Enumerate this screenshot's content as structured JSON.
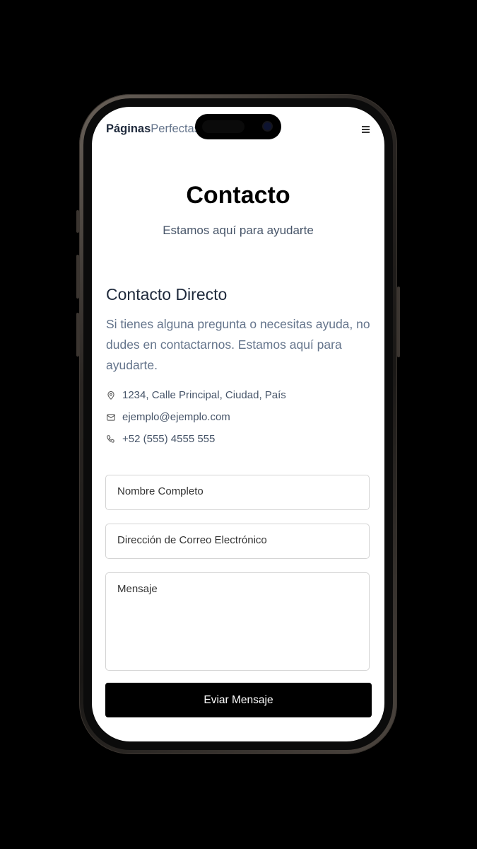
{
  "header": {
    "brand_bold": "Páginas",
    "brand_light": "Perfectas",
    "menu_icon": "hamburger-menu-icon"
  },
  "hero": {
    "title": "Contacto",
    "subtitle": "Estamos aquí para ayudarte"
  },
  "contact": {
    "heading": "Contacto Directo",
    "description": "Si tienes alguna pregunta o necesitas ayuda, no dudes en contactarnos. Estamos aquí para ayudarte.",
    "items": [
      {
        "icon": "map-pin-icon",
        "text": "1234, Calle Principal, Ciudad, País"
      },
      {
        "icon": "mail-icon",
        "text": "ejemplo@ejemplo.com"
      },
      {
        "icon": "phone-icon",
        "text": "+52 (555) 4555 555"
      }
    ]
  },
  "form": {
    "name_placeholder": "Nombre Completo",
    "email_placeholder": "Dirección de Correo Electrónico",
    "message_placeholder": "Mensaje",
    "submit_label": "Eviar Mensaje"
  }
}
